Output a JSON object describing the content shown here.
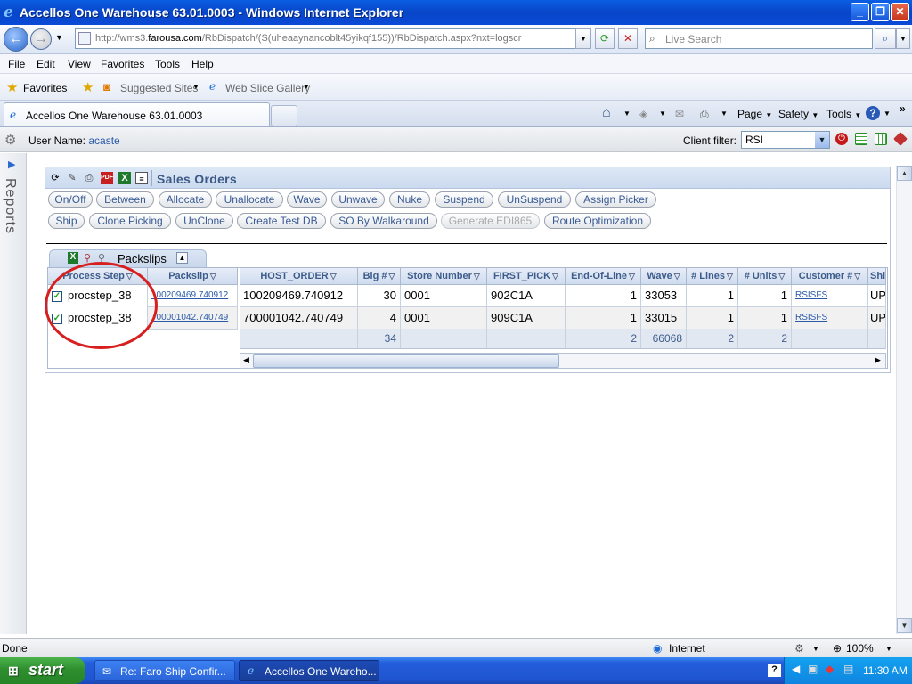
{
  "window": {
    "title": "Accellos One Warehouse 63.01.0003 - Windows Internet Explorer",
    "minimize": "_",
    "restore": "❐",
    "close": "✕"
  },
  "address": {
    "prefix": "http://wms3.",
    "domain": "farousa.com",
    "suffix": "/RbDispatch/(S(uheaaynancoblt45yikqf155))/RbDispatch.aspx?nxt=logscr",
    "search_placeholder": "Live Search"
  },
  "menu": {
    "file": "File",
    "edit": "Edit",
    "view": "View",
    "favorites": "Favorites",
    "tools": "Tools",
    "help": "Help"
  },
  "favorites_bar": {
    "favorites": "Favorites",
    "suggested": "Suggested Sites",
    "slice": "Web Slice Gallery"
  },
  "tabs": {
    "active": "Accellos One Warehouse 63.01.0003",
    "page": "Page",
    "safety": "Safety",
    "tools": "Tools",
    "more": "»"
  },
  "app": {
    "user_label": "User Name:",
    "user_name": "acaste",
    "client_filter_label": "Client filter:",
    "client_filter_value": "RSI",
    "side_label": "Reports"
  },
  "sales_orders": {
    "title": "Sales Orders",
    "buttons_row1": [
      "On/Off",
      "Between",
      "Allocate",
      "Unallocate",
      "Wave",
      "Unwave",
      "Nuke",
      "Suspend",
      "UnSuspend",
      "Assign Picker"
    ],
    "buttons_row2": [
      "Ship",
      "Clone Picking",
      "UnClone",
      "Create Test DB",
      "SO By Walkaround",
      "Generate EDI865",
      "Route Optimization"
    ]
  },
  "packslips": {
    "title": "Packslips",
    "columns": [
      "Process Step",
      "Packslip",
      "HOST_ORDER",
      "Big #",
      "Store Number",
      "FIRST_PICK",
      "End-Of-Line",
      "Wave",
      "# Lines",
      "# Units",
      "Customer #",
      "Shi"
    ],
    "rows": [
      {
        "process_step": "procstep_38",
        "packslip": "100209469.740912",
        "host_order": "100209469.740912",
        "big": "30",
        "store": "0001",
        "first_pick": "902C1A",
        "eol": "1",
        "wave": "33053",
        "lines": "1",
        "units": "1",
        "customer": "RSISFS",
        "ship": "UP"
      },
      {
        "process_step": "procstep_38",
        "packslip": "700001042.740749",
        "host_order": "700001042.740749",
        "big": "4",
        "store": "0001",
        "first_pick": "909C1A",
        "eol": "1",
        "wave": "33015",
        "lines": "1",
        "units": "1",
        "customer": "RSISFS",
        "ship": "UP"
      }
    ],
    "totals": {
      "big": "34",
      "eol": "2",
      "wave": "66068",
      "lines": "2",
      "units": "2"
    }
  },
  "statusbar": {
    "text": "Done",
    "zone": "Internet",
    "zoom": "100%"
  },
  "taskbar": {
    "start": "start",
    "task1": "Re: Faro Ship Confir...",
    "task2": "Accellos One Wareho...",
    "clock": "11:30 AM"
  },
  "colors": {
    "annotation": "#d71f1f",
    "link": "#2a5aa8",
    "header_text": "#3d5c8c"
  }
}
